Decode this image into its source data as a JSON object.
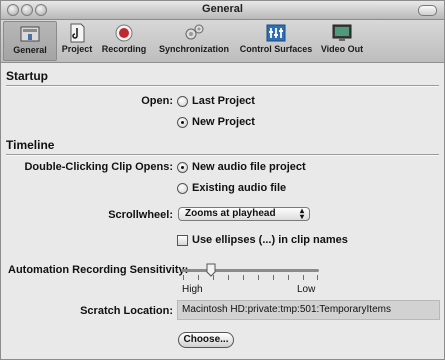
{
  "window": {
    "title": "General"
  },
  "toolbar": {
    "items": [
      {
        "label": "General",
        "icon": "general-icon",
        "selected": true
      },
      {
        "label": "Project",
        "icon": "project-icon"
      },
      {
        "label": "Recording",
        "icon": "record-icon"
      },
      {
        "label": "Synchronization",
        "icon": "sync-icon"
      },
      {
        "label": "Control Surfaces",
        "icon": "control-surfaces-icon"
      },
      {
        "label": "Video Out",
        "icon": "video-out-icon"
      }
    ]
  },
  "startup": {
    "heading": "Startup",
    "open_label": "Open:",
    "options": [
      "Last Project",
      "New Project"
    ],
    "selected": "New Project"
  },
  "timeline": {
    "heading": "Timeline",
    "double_click_label": "Double-Clicking Clip Opens:",
    "double_click_options": [
      "New audio file project",
      "Existing audio file"
    ],
    "double_click_selected": "New audio file project",
    "scrollwheel_label": "Scrollwheel:",
    "scrollwheel_value": "Zooms at playhead",
    "ellipses_label": "Use ellipses (...) in clip names",
    "ellipses_checked": false
  },
  "automation": {
    "label": "Automation Recording Sensitivity:",
    "high_label": "High",
    "low_label": "Low",
    "value_fraction": 0.22
  },
  "scratch": {
    "label": "Scratch Location:",
    "path": "Macintosh HD:private:tmp:501:TemporaryItems",
    "choose_label": "Choose..."
  },
  "colors": {
    "window_bg": "#e9e9e9",
    "toolbar_bg": "#c8c8c8",
    "record_red": "#c1272d",
    "sync_blue": "#2f6fb6"
  }
}
